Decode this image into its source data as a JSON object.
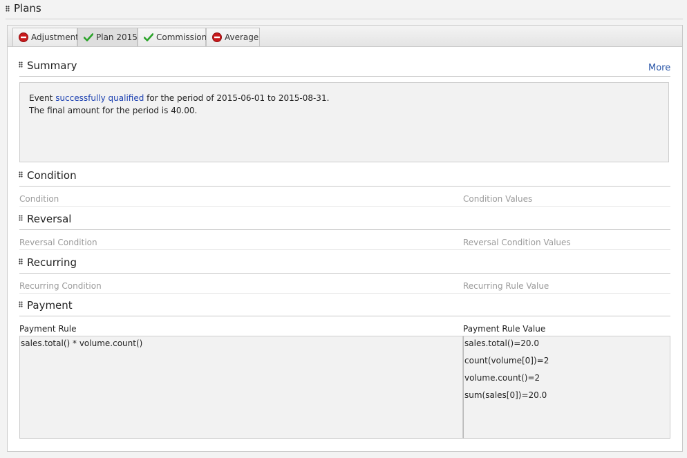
{
  "plans": {
    "title": "Plans"
  },
  "tabs": [
    {
      "label": "Adjustment",
      "status": "error",
      "icon": "minus-circle-icon"
    },
    {
      "label": "Plan 2015",
      "status": "ok",
      "icon": "checkmark-icon",
      "active": true
    },
    {
      "label": "Commission",
      "status": "ok",
      "icon": "checkmark-icon"
    },
    {
      "label": "Average",
      "status": "error",
      "icon": "minus-circle-icon"
    }
  ],
  "colors": {
    "error": "#c8191b",
    "ok": "#2aa329",
    "link": "#2a56a8",
    "highlight": "#1a3fb0"
  },
  "summary": {
    "title": "Summary",
    "more_label": "More",
    "line1_prefix": "Event ",
    "line1_highlight": "successfully qualified",
    "line1_mid": " for the period of ",
    "period": "2015-06-01 to 2015-08-31",
    "line1_end": ".",
    "line2_prefix": "The final amount for the period is ",
    "amount": "40.00",
    "line2_end": "."
  },
  "condition": {
    "title": "Condition",
    "col1": "Condition",
    "col2": "Condition Values"
  },
  "reversal": {
    "title": "Reversal",
    "col1": "Reversal Condition",
    "col2": "Reversal Condition Values"
  },
  "recurring": {
    "title": "Recurring",
    "col1": "Recurring Condition",
    "col2": "Recurring Rule Value"
  },
  "payment": {
    "title": "Payment",
    "col1": "Payment Rule",
    "col2": "Payment Rule Value",
    "rule": "sales.total() * volume.count()",
    "values": [
      "sales.total()=20.0",
      "count(volume[0])=2",
      "volume.count()=2",
      "sum(sales[0])=20.0"
    ]
  }
}
